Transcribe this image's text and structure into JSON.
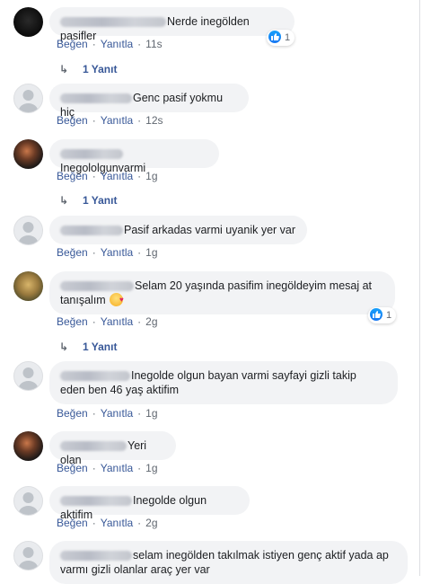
{
  "labels": {
    "like": "Beğen",
    "reply": "Yanıtla",
    "separator": "·"
  },
  "comments": [
    {
      "text": "Nerde inegölden pasifler",
      "time": "11s",
      "reactions": "1",
      "replies": "1 Yanıt"
    },
    {
      "text": "Genc pasif yokmu hiç",
      "time": "12s"
    },
    {
      "text": "Inegololgunvarmi",
      "time": "1g",
      "replies": "1 Yanıt"
    },
    {
      "text": "Pasif arkadas varmi uyanik yer var",
      "time": "1g"
    },
    {
      "text_line1": "Selam 20 yaşında pasifim inegöldeyim mesaj at",
      "text_line2": "tanışalım",
      "time": "2g",
      "reactions": "1",
      "replies": "1 Yanıt"
    },
    {
      "text_line1": "Inegolde olgun bayan varmi sayfayi gizli takip",
      "text_line2": "eden ben 46 yaş aktifim",
      "time": "1g"
    },
    {
      "text": "Yeri olan",
      "time": "1g"
    },
    {
      "text": "Inegolde olgun aktifim",
      "time": "2g"
    },
    {
      "text_line1": "selam inegölden takılmak istiyen genç aktif yada ap",
      "text_line2": "varmı gizli olanlar araç yer var"
    }
  ]
}
